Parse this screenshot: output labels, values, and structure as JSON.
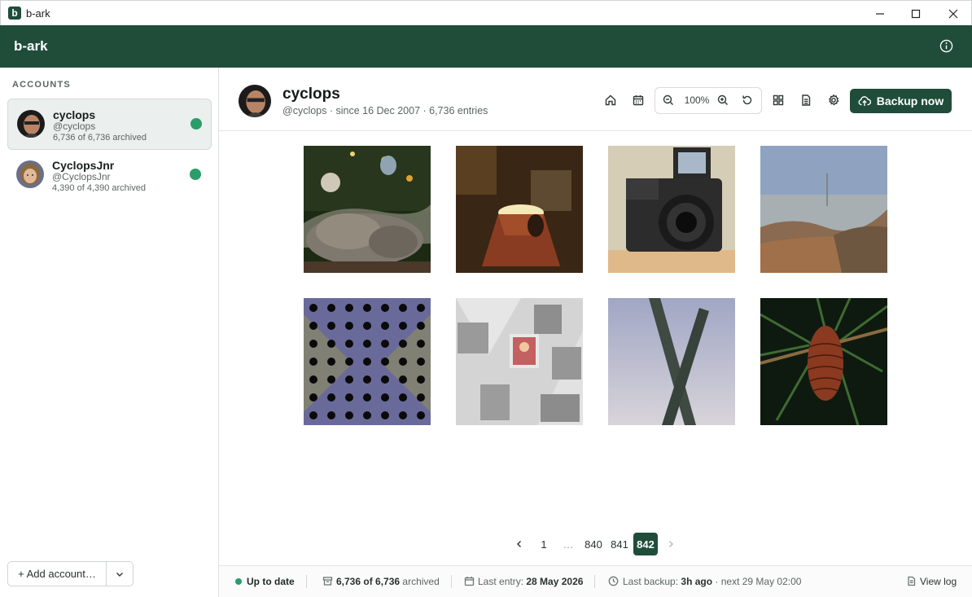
{
  "window": {
    "title": "b-ark",
    "app_glyph": "b"
  },
  "header": {
    "brand": "b-ark"
  },
  "sidebar": {
    "heading": "ACCOUNTS",
    "accounts": [
      {
        "name": "cyclops",
        "handle": "@cyclops",
        "archived": "6,736 of 6,736 archived",
        "status_color": "#2a9d6b",
        "active": true
      },
      {
        "name": "CyclopsJnr",
        "handle": "@CyclopsJnr",
        "archived": "4,390 of 4,390 archived",
        "status_color": "#2a9d6b",
        "active": false
      }
    ],
    "add_account": "+ Add account…"
  },
  "profile": {
    "name": "cyclops",
    "meta": "@cyclops · since 16 Dec 2007 · 6,736 entries",
    "zoom": "100%",
    "backup_label": "Backup now"
  },
  "photos": [
    {
      "subject": "cat sleeping under christmas tree"
    },
    {
      "subject": "lamp"
    },
    {
      "subject": "camera"
    },
    {
      "subject": "misty hills with mast"
    },
    {
      "subject": "perforated metal"
    },
    {
      "subject": "stamps"
    },
    {
      "subject": "frosted X"
    },
    {
      "subject": "pine cone"
    }
  ],
  "pager": {
    "first": "1",
    "ellipsis": "…",
    "pages": [
      "840",
      "841"
    ],
    "current": "842"
  },
  "status": {
    "state": "Up to date",
    "archived_bold": "6,736 of 6,736",
    "archived_suffix": " archived",
    "last_entry_label": "Last entry: ",
    "last_entry_value": "28 May 2026",
    "last_backup_label": "Last backup: ",
    "last_backup_value": "3h ago",
    "next_backup": " · next 29 May 02:00",
    "view_log": "View log"
  },
  "colors": {
    "brand": "#1f4d3a",
    "status_ok": "#2a9d6b"
  }
}
